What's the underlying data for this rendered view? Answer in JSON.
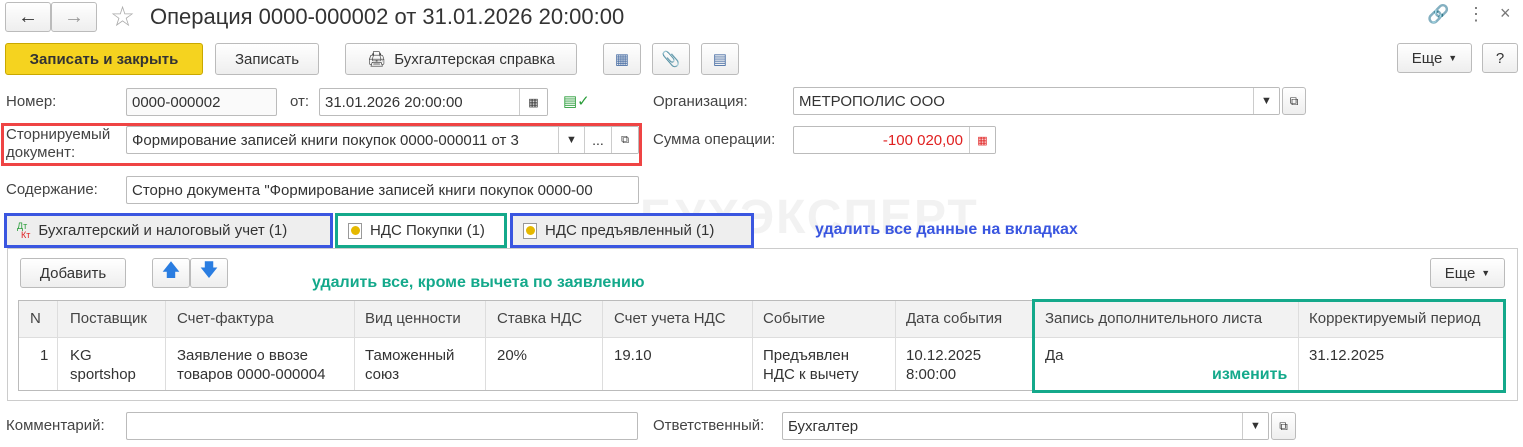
{
  "window": {
    "title": "Операция 0000-000002 от 31.01.2026 20:00:00"
  },
  "toolbar": {
    "save_close": "Записать и закрыть",
    "save": "Записать",
    "report": "Бухгалтерская справка",
    "more": "Еще",
    "help": "?"
  },
  "form": {
    "number_label": "Номер:",
    "number": "0000-000002",
    "date_label": "от:",
    "date": "31.01.2026 20:00:00",
    "org_label": "Организация:",
    "org": "МЕТРОПОЛИС ООО",
    "storno_label": "Сторнируемый документ:",
    "storno": "Формирование записей книги покупок 0000-000011 от 3",
    "sum_label": "Сумма операции:",
    "sum": "-100 020,00",
    "content_label": "Содержание:",
    "content": "Сторно документа \"Формирование записей книги покупок 0000-00",
    "comment_label": "Комментарий:",
    "comment": "",
    "resp_label": "Ответственный:",
    "resp": "Бухгалтер"
  },
  "tabs": [
    {
      "label": "Бухгалтерский и налоговый учет (1)"
    },
    {
      "label": "НДС Покупки (1)"
    },
    {
      "label": "НДС предъявленный (1)"
    }
  ],
  "tab_icon": {
    "dt": "Дт",
    "kt": "Кт"
  },
  "panel": {
    "add": "Добавить",
    "more": "Еще"
  },
  "table": {
    "headers": [
      "N",
      "Поставщик",
      "Счет-фактура",
      "Вид ценности",
      "Ставка НДС",
      "Счет учета НДС",
      "Событие",
      "Дата события",
      "Запись дополнительного листа",
      "Корректируемый период"
    ],
    "rows": [
      [
        "1",
        "KG sportshop",
        "Заявление о ввозе товаров 0000-000004",
        "Таможенный союз",
        "20%",
        "19.10",
        "Предъявлен НДС к вычету",
        "10.12.2025 8:00:00",
        "Да",
        "31.12.2025"
      ]
    ]
  },
  "annotations": {
    "tabs": "удалить все данные на вкладках",
    "keep": "удалить все, кроме вычета по заявлению",
    "change": "изменить"
  },
  "watermark": "БУХЭКСПЕРТ",
  "colors": {
    "red": "#ef4444",
    "blue": "#3a56e0",
    "green": "#14a98b",
    "yellow": "#f5d31f"
  }
}
